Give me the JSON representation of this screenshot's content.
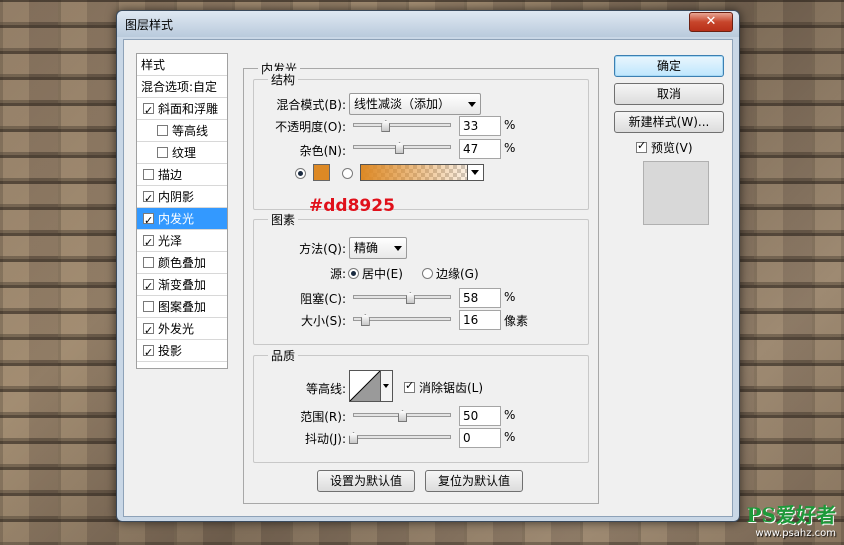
{
  "window": {
    "title": "图层样式",
    "close_label": "✕"
  },
  "styles_panel": {
    "header": "样式",
    "blend_options": "混合选项:自定",
    "items": [
      {
        "label": "斜面和浮雕",
        "checked": true
      },
      {
        "label": "等高线",
        "checked": false
      },
      {
        "label": "纹理",
        "checked": false
      },
      {
        "label": "描边",
        "checked": false
      },
      {
        "label": "内阴影",
        "checked": true
      },
      {
        "label": "内发光",
        "checked": true
      },
      {
        "label": "光泽",
        "checked": true
      },
      {
        "label": "颜色叠加",
        "checked": false
      },
      {
        "label": "渐变叠加",
        "checked": true
      },
      {
        "label": "图案叠加",
        "checked": false
      },
      {
        "label": "外发光",
        "checked": true
      },
      {
        "label": "投影",
        "checked": true
      }
    ]
  },
  "inner_glow": {
    "title": "内发光",
    "structure": {
      "title": "结构",
      "blend_mode_label": "混合模式(B):",
      "blend_mode_value": "线性减淡（添加）",
      "opacity_label": "不透明度(O):",
      "opacity_value": "33",
      "noise_label": "杂色(N):",
      "noise_value": "47",
      "percent": "%",
      "glow_color": "#dd8925"
    },
    "elements": {
      "title": "图素",
      "technique_label": "方法(Q):",
      "technique_value": "精确",
      "source_label": "源:",
      "source_center": "居中(E)",
      "source_edge": "边缘(G)",
      "choke_label": "阻塞(C):",
      "choke_value": "58",
      "size_label": "大小(S):",
      "size_value": "16",
      "size_unit": "像素",
      "percent": "%"
    },
    "quality": {
      "title": "品质",
      "contour_label": "等高线:",
      "antialias_label": "消除锯齿(L)",
      "range_label": "范围(R):",
      "range_value": "50",
      "jitter_label": "抖动(J):",
      "jitter_value": "0",
      "percent": "%"
    },
    "make_default": "设置为默认值",
    "reset_default": "复位为默认值"
  },
  "annotation": {
    "hex_label": "#dd8925"
  },
  "buttons": {
    "ok": "确定",
    "cancel": "取消",
    "new_style": "新建样式(W)...",
    "preview": "预览(V)"
  },
  "watermark": {
    "main": "PS爱好者",
    "url": "www.psahz.com"
  }
}
